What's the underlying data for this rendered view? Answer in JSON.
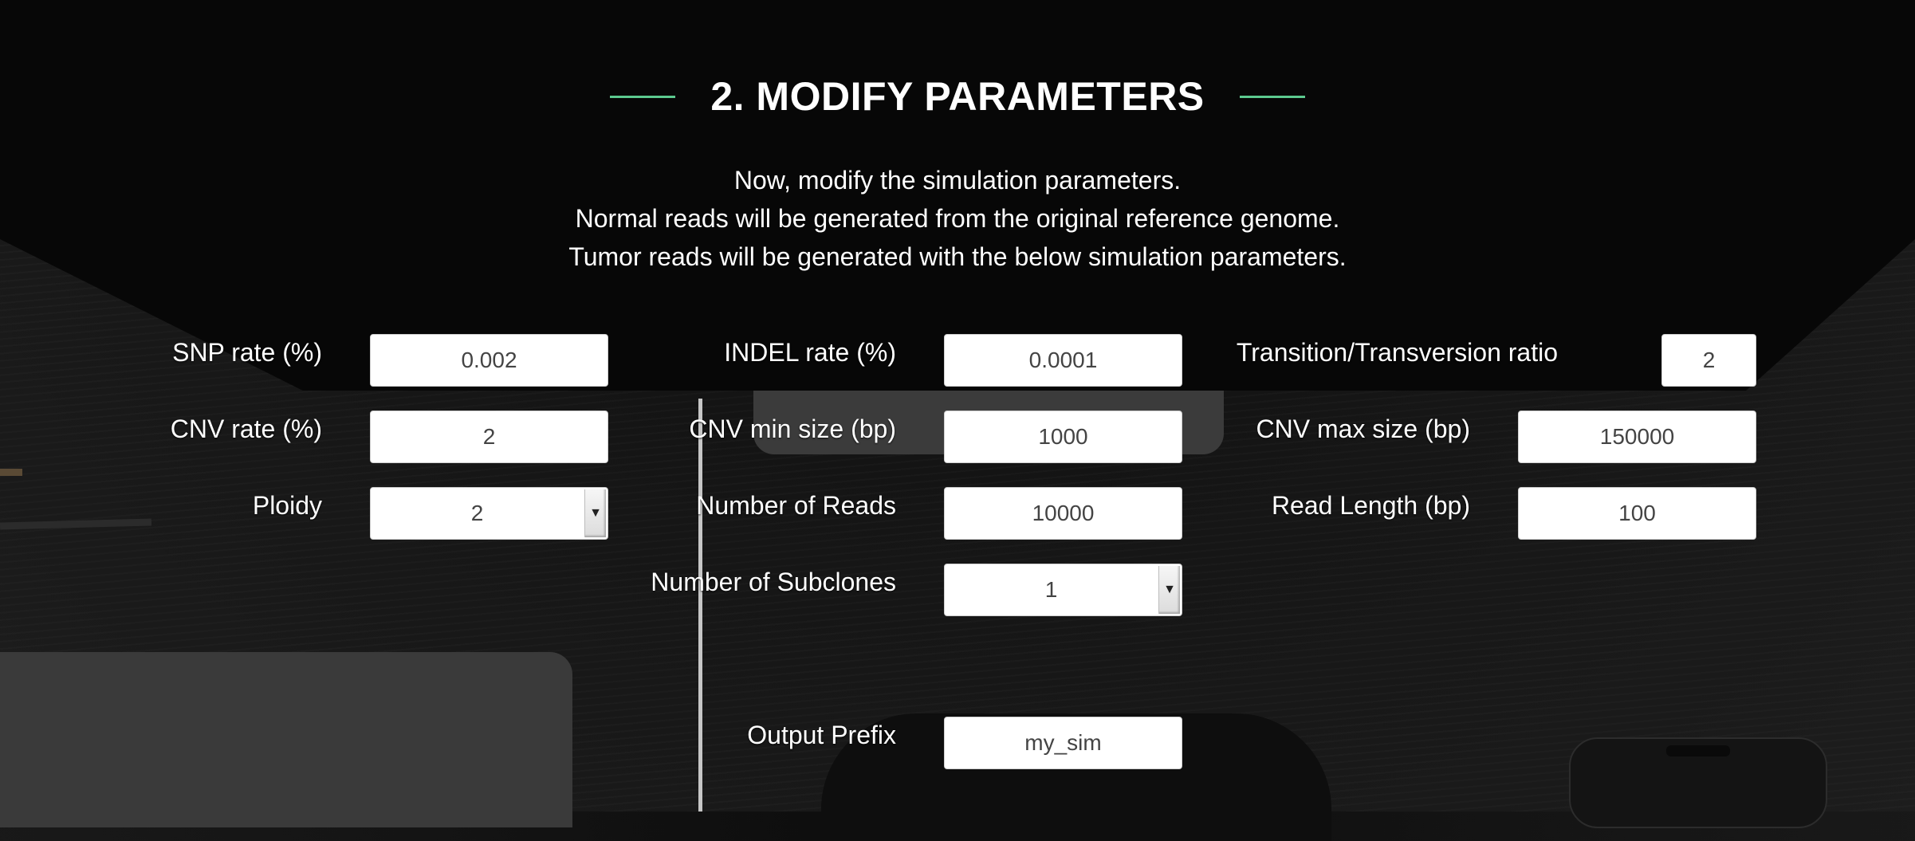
{
  "section": {
    "title": "2. MODIFY PARAMETERS",
    "accent_color": "#5cc98f",
    "intro_lines": [
      "Now, modify the simulation parameters.",
      "Normal reads will be generated from the original reference genome.",
      "Tumor reads will be generated with the below simulation parameters."
    ]
  },
  "params": {
    "snp_rate": {
      "label": "SNP rate (%)",
      "value": "0.002"
    },
    "indel_rate": {
      "label": "INDEL rate (%)",
      "value": "0.0001"
    },
    "titv_ratio": {
      "label": "Transition/Transversion ratio",
      "value": "2"
    },
    "cnv_rate": {
      "label": "CNV rate (%)",
      "value": "2"
    },
    "cnv_min": {
      "label": "CNV min size (bp)",
      "value": "1000"
    },
    "cnv_max": {
      "label": "CNV max size (bp)",
      "value": "150000"
    },
    "ploidy": {
      "label": "Ploidy",
      "value": "2",
      "arrow_icon": "chevron-down-icon"
    },
    "num_reads": {
      "label": "Number of Reads",
      "value": "10000"
    },
    "read_length": {
      "label": "Read Length (bp)",
      "value": "100"
    },
    "num_subclones": {
      "label": "Number of Subclones",
      "value": "1",
      "arrow_icon": "chevron-down-icon"
    },
    "output_prefix": {
      "label": "Output Prefix",
      "value": "my_sim"
    }
  }
}
